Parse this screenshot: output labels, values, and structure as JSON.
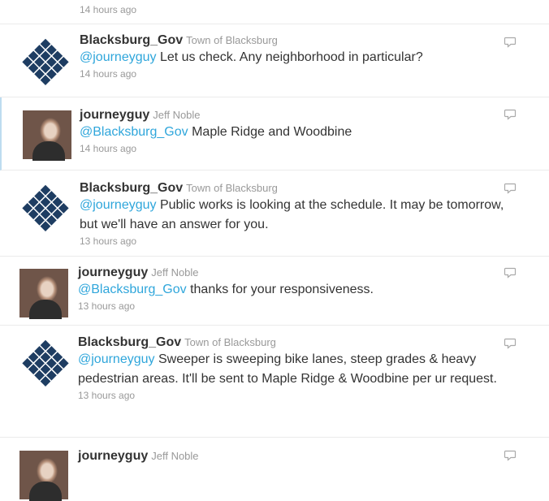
{
  "top_stub": {
    "timestamp": "14 hours ago"
  },
  "tweets": [
    {
      "avatar": "government-logo-icon",
      "handle": "Blacksburg_Gov",
      "fullname": "Town of Blacksburg",
      "mention": "@journeyguy",
      "text": " Let us check. Any neighborhood in particular?",
      "timestamp": "14 hours ago"
    },
    {
      "avatar": "user-photo",
      "handle": "journeyguy",
      "fullname": "Jeff Noble",
      "mention": "@Blacksburg_Gov",
      "text": " Maple Ridge and Woodbine",
      "timestamp": "14 hours ago"
    },
    {
      "avatar": "government-logo-icon",
      "handle": "Blacksburg_Gov",
      "fullname": "Town of Blacksburg",
      "mention": "@journeyguy",
      "text": " Public works is looking at the schedule. It may be tomorrow, but we'll have an answer for you.",
      "timestamp": "13 hours ago"
    },
    {
      "avatar": "user-photo",
      "handle": "journeyguy",
      "fullname": "Jeff Noble",
      "mention": "@Blacksburg_Gov",
      "text": " thanks for your responsiveness.",
      "timestamp": "13 hours ago"
    },
    {
      "avatar": "government-logo-icon",
      "handle": "Blacksburg_Gov",
      "fullname": "Town of Blacksburg",
      "mention": "@journeyguy",
      "text": " Sweeper is sweeping bike lanes, steep grades & heavy pedestrian areas. It'll be sent to Maple Ridge & Woodbine per ur request.",
      "timestamp": "13 hours ago"
    },
    {
      "avatar": "user-photo",
      "handle": "journeyguy",
      "fullname": "Jeff Noble"
    }
  ],
  "colors": {
    "link": "#2fa6db",
    "text": "#333333",
    "muted": "#999999",
    "logo": "#1e3d62"
  }
}
